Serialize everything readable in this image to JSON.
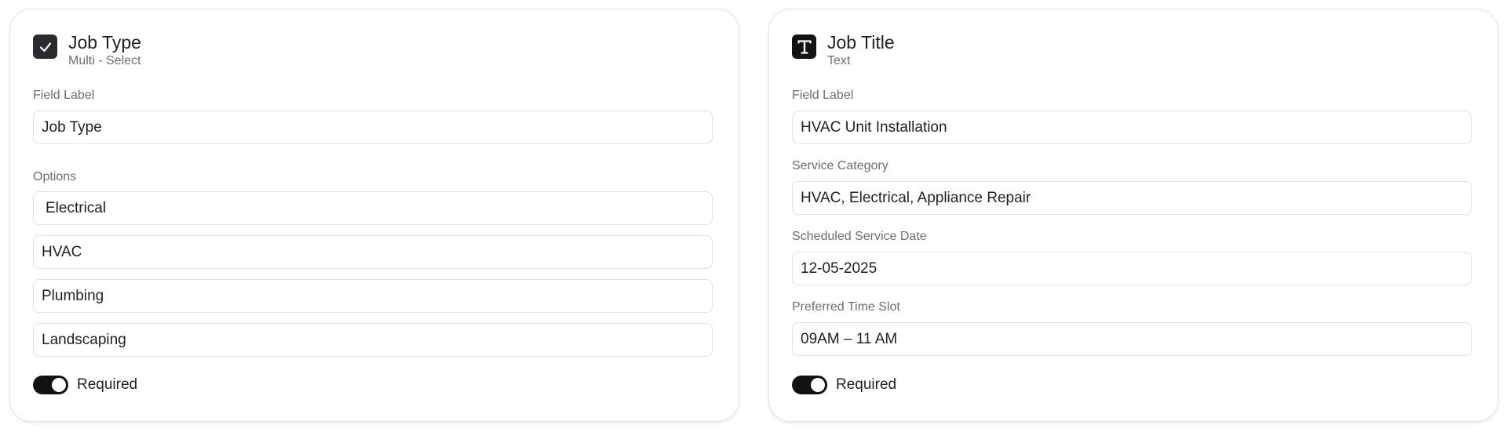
{
  "job_type_card": {
    "title": "Job Type",
    "subtitle": "Multi - Select",
    "icon": "checkbox-icon",
    "field_label_caption": "Field Label",
    "field_label_value": "Job Type",
    "options_caption": "Options",
    "options": [
      "Electrical",
      "HVAC",
      "Plumbing",
      "Landscaping"
    ],
    "required_label": "Required",
    "required_on": true
  },
  "job_title_card": {
    "title": "Job Title",
    "subtitle": "Text",
    "icon": "text-type-icon",
    "field_label_caption": "Field Label",
    "field_label_value": "HVAC Unit Installation",
    "service_category_caption": "Service Category",
    "service_category_value": "HVAC, Electrical, Appliance Repair",
    "scheduled_date_caption": "Scheduled Service Date",
    "scheduled_date_value": "12-05-2025",
    "time_slot_caption": "Preferred Time Slot",
    "time_slot_value": "09AM – 11 AM",
    "required_label": "Required",
    "required_on": true
  },
  "colors": {
    "toggle_on": "#111214",
    "icon_bg": "#2a2b2f",
    "border": "#e2e3e7",
    "muted_text": "#6b6e77"
  }
}
